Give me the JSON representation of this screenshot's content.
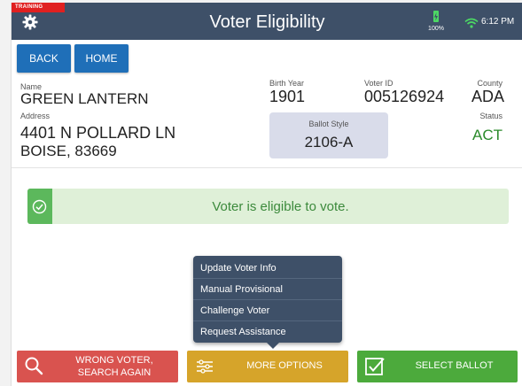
{
  "header": {
    "training_badge": "TRAINING",
    "title": "Voter Eligibility",
    "battery_percent": "100%",
    "time": "6:12 PM"
  },
  "nav": {
    "back_label": "BACK",
    "home_label": "HOME"
  },
  "voter": {
    "name_label": "Name",
    "name": "GREEN LANTERN",
    "address_label": "Address",
    "address_line1": "4401 N POLLARD  LN",
    "address_line2": "BOISE, 83669",
    "birth_year_label": "Birth Year",
    "birth_year": "1901",
    "voter_id_label": "Voter ID",
    "voter_id": "005126924",
    "county_label": "County",
    "county": "ADA",
    "status_label": "Status",
    "status": "ACT",
    "ballot_style_label": "Ballot Style",
    "ballot_style": "2106-A"
  },
  "eligibility": {
    "message": "Voter is eligible to vote."
  },
  "more_menu": {
    "items": [
      {
        "label": "Update Voter Info"
      },
      {
        "label": "Manual Provisional"
      },
      {
        "label": "Challenge Voter"
      },
      {
        "label": "Request Assistance"
      }
    ]
  },
  "actions": {
    "wrong_voter_line1": "WRONG VOTER,",
    "wrong_voter_line2": "SEARCH AGAIN",
    "more_options": "MORE OPTIONS",
    "select_ballot": "SELECT BALLOT"
  },
  "colors": {
    "header_bg": "#3e5068",
    "nav_button": "#1f6fb8",
    "training_red": "#e02020",
    "status_green": "#2a8a2a",
    "banner_bg": "#dff0d8",
    "banner_icon": "#5cb85c",
    "wrong_red": "#d9534f",
    "more_gold": "#d6a42a",
    "select_green": "#4caa3c"
  },
  "icons": {
    "settings": "gear-icon",
    "battery": "battery-charging-icon",
    "wifi": "wifi-icon",
    "eligible": "check-circle-icon",
    "search": "search-icon",
    "options": "sliders-icon",
    "select": "checkbox-icon"
  }
}
